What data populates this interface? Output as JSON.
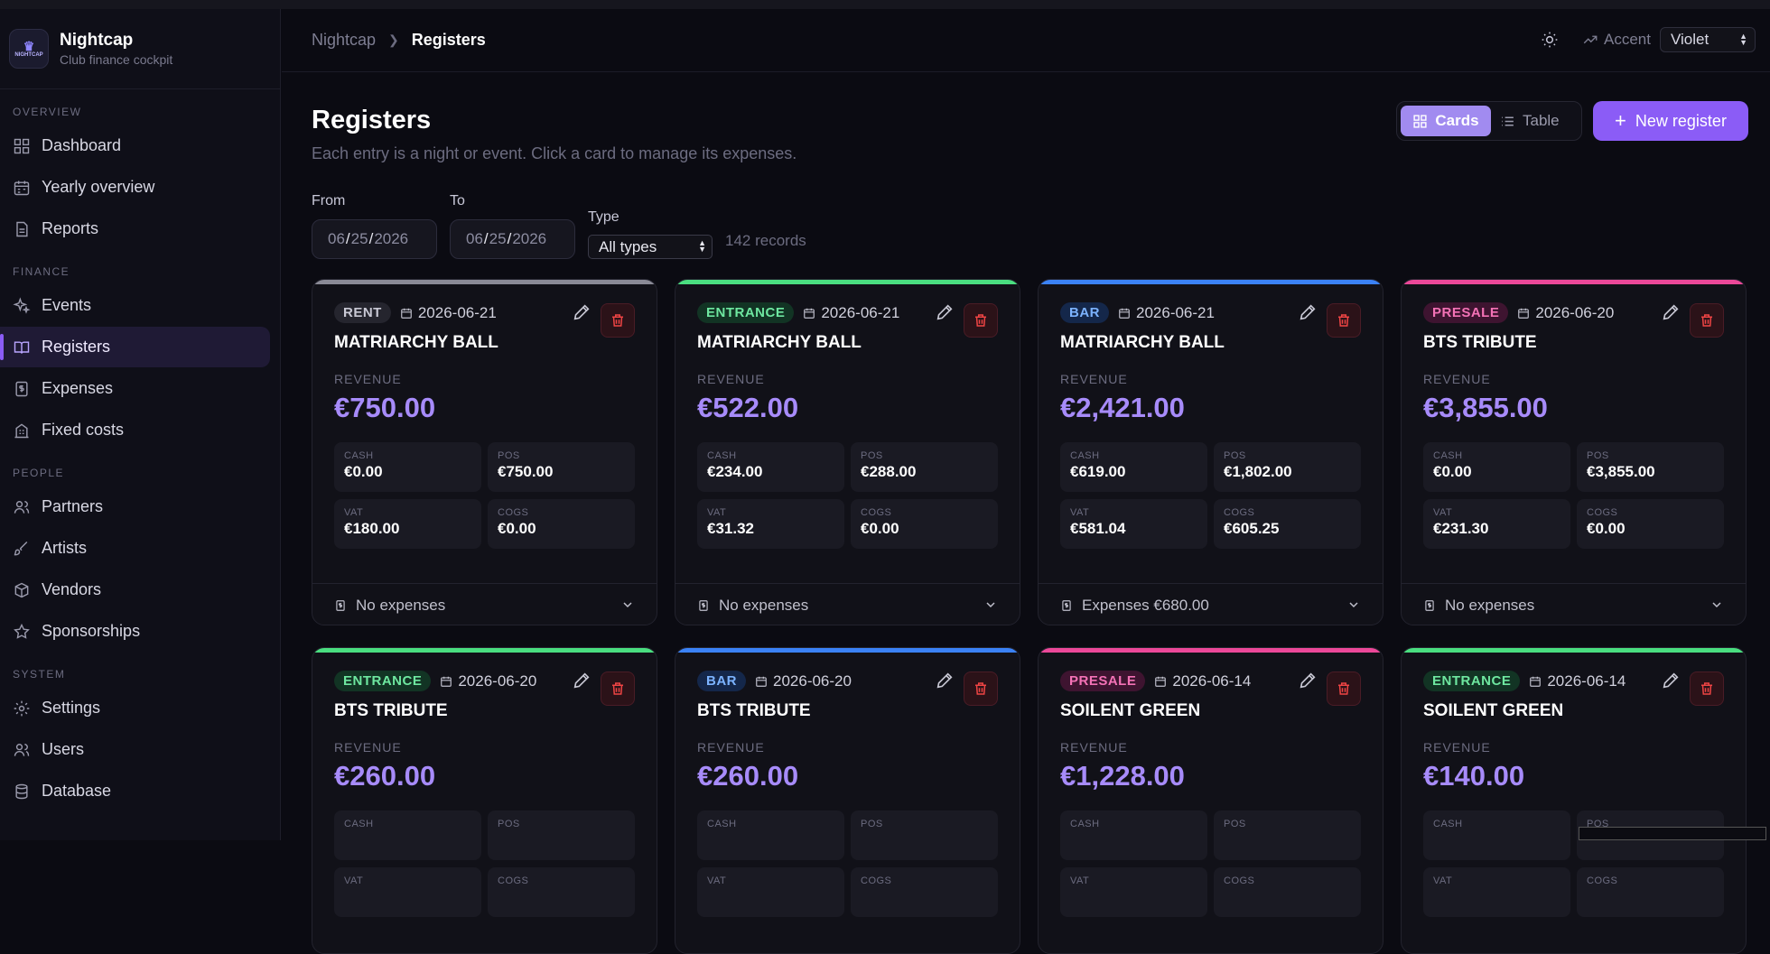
{
  "app": {
    "name": "Nightcap",
    "subtitle": "Club finance cockpit",
    "logo_text": "NIGHTCAP"
  },
  "sidebar": {
    "sections": [
      {
        "label": "OVERVIEW",
        "items": [
          {
            "label": "Dashboard",
            "icon": "grid-icon"
          },
          {
            "label": "Yearly overview",
            "icon": "calendar-icon"
          },
          {
            "label": "Reports",
            "icon": "document-icon"
          }
        ]
      },
      {
        "label": "FINANCE",
        "items": [
          {
            "label": "Events",
            "icon": "sparkles-icon"
          },
          {
            "label": "Registers",
            "icon": "book-open-icon",
            "active": true
          },
          {
            "label": "Expenses",
            "icon": "receipt-icon"
          },
          {
            "label": "Fixed costs",
            "icon": "building-icon"
          }
        ]
      },
      {
        "label": "PEOPLE",
        "items": [
          {
            "label": "Partners",
            "icon": "users-icon"
          },
          {
            "label": "Artists",
            "icon": "brush-icon"
          },
          {
            "label": "Vendors",
            "icon": "box-icon"
          },
          {
            "label": "Sponsorships",
            "icon": "star-icon"
          }
        ]
      },
      {
        "label": "SYSTEM",
        "items": [
          {
            "label": "Settings",
            "icon": "gear-icon"
          },
          {
            "label": "Users",
            "icon": "users-icon"
          },
          {
            "label": "Database",
            "icon": "database-icon"
          }
        ]
      }
    ]
  },
  "header": {
    "breadcrumb": [
      "Nightcap",
      "Registers"
    ],
    "accent_label": "Accent",
    "accent_value": "Violet"
  },
  "page": {
    "title": "Registers",
    "subtitle": "Each entry is a night or event. Click a card to manage its expenses.",
    "view_toggle": {
      "cards": "Cards",
      "table": "Table",
      "selected": "Cards"
    },
    "new_button": "New register"
  },
  "filters": {
    "from_label": "From",
    "from_value": {
      "mm": "06",
      "dd": "25",
      "yyyy": "2026"
    },
    "to_label": "To",
    "to_value": {
      "mm": "06",
      "dd": "25",
      "yyyy": "2026"
    },
    "type_label": "Type",
    "type_value": "All types",
    "records": "142 records"
  },
  "labels": {
    "revenue": "REVENUE",
    "cash": "CASH",
    "pos": "POS",
    "vat": "VAT",
    "cogs": "COGS"
  },
  "colors": {
    "accent": "#8b5cf6",
    "revenue": "#a78bfa",
    "rent": "#8a8a96",
    "entrance": "#4ade80",
    "bar": "#3b82f6",
    "presale": "#ec4899"
  },
  "cards": [
    {
      "type": "RENT",
      "date": "2026-06-21",
      "name": "MATRIARCHY BALL",
      "revenue": "€750.00",
      "cash": "€0.00",
      "pos": "€750.00",
      "vat": "€180.00",
      "cogs": "€0.00",
      "expenses": "No expenses"
    },
    {
      "type": "ENTRANCE",
      "date": "2026-06-21",
      "name": "MATRIARCHY BALL",
      "revenue": "€522.00",
      "cash": "€234.00",
      "pos": "€288.00",
      "vat": "€31.32",
      "cogs": "€0.00",
      "expenses": "No expenses"
    },
    {
      "type": "BAR",
      "date": "2026-06-21",
      "name": "MATRIARCHY BALL",
      "revenue": "€2,421.00",
      "cash": "€619.00",
      "pos": "€1,802.00",
      "vat": "€581.04",
      "cogs": "€605.25",
      "expenses": "Expenses €680.00"
    },
    {
      "type": "PRESALE",
      "date": "2026-06-20",
      "name": "BTS TRIBUTE",
      "revenue": "€3,855.00",
      "cash": "€0.00",
      "pos": "€3,855.00",
      "vat": "€231.30",
      "cogs": "€0.00",
      "expenses": "No expenses"
    },
    {
      "type": "ENTRANCE",
      "date": "2026-06-20",
      "name": "BTS TRIBUTE",
      "revenue": "€260.00"
    },
    {
      "type": "BAR",
      "date": "2026-06-20",
      "name": "BTS TRIBUTE",
      "revenue": "€260.00"
    },
    {
      "type": "PRESALE",
      "date": "2026-06-14",
      "name": "SOILENT GREEN",
      "revenue": "€1,228.00"
    },
    {
      "type": "ENTRANCE",
      "date": "2026-06-14",
      "name": "SOILENT GREEN",
      "revenue": "€140.00"
    }
  ]
}
